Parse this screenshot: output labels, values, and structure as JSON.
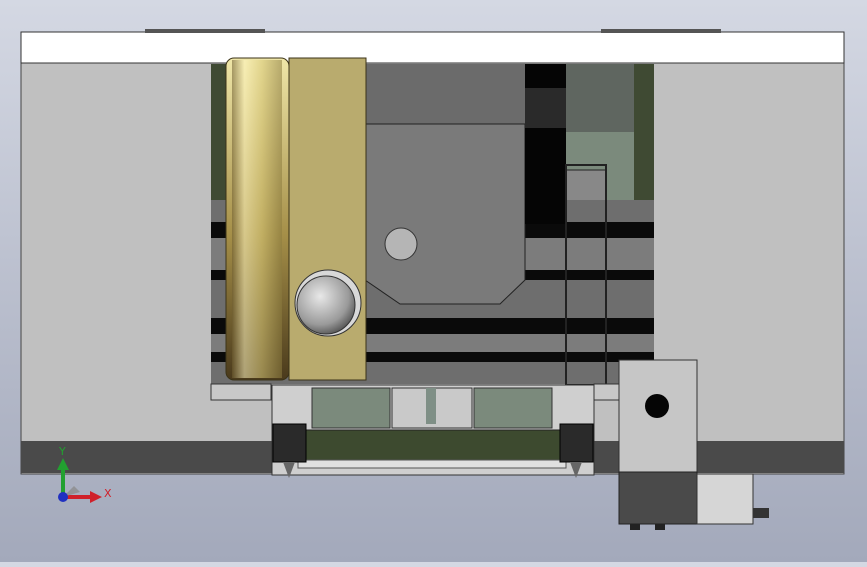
{
  "viewport": {
    "name": "cad-model-front-view",
    "background_top": "#d4d8e3",
    "background_bottom": "#a3a9bb"
  },
  "colors": {
    "white_cover": "#ffffff",
    "body_gray": "#bfbfbf",
    "dark_gray": "#3a3a3a",
    "mid_gray": "#6e6e6e",
    "green_dark": "#3d4a2f",
    "green_gray": "#7b8a7c",
    "brass": "#b9ab6e",
    "brass_light": "#e6dc9a",
    "black": "#0a0a0a"
  },
  "triad": {
    "x_label": "X",
    "y_label": "Y",
    "x_color": "#d0202a",
    "y_color": "#22a030",
    "z_color": "#2030c0"
  }
}
